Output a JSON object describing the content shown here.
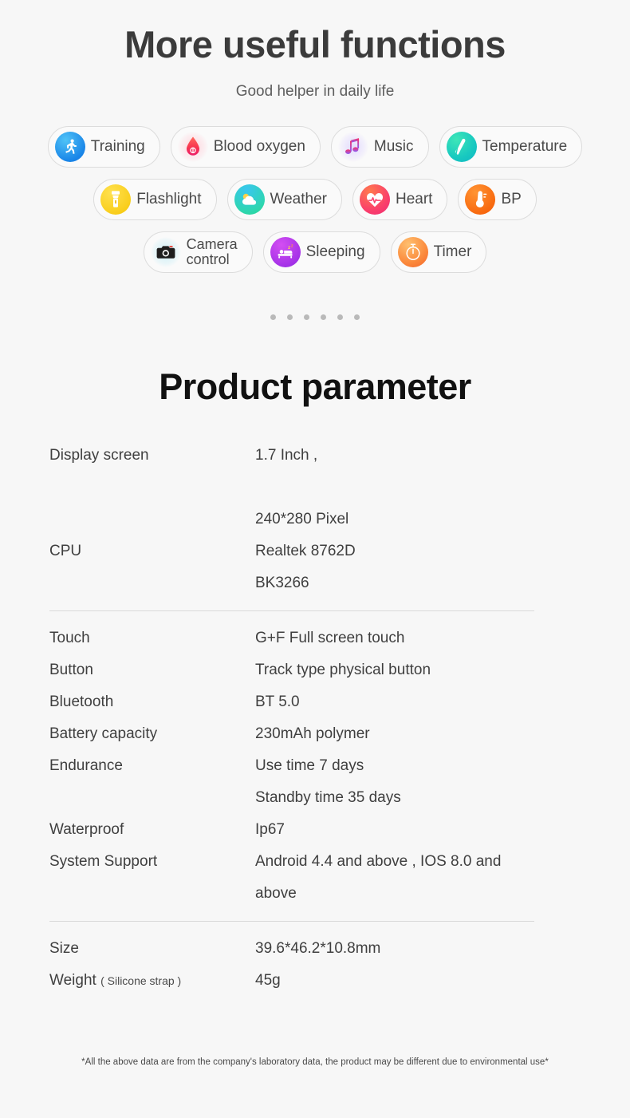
{
  "header": {
    "title": "More useful functions",
    "subtitle": "Good helper in daily life"
  },
  "features": {
    "rows": [
      [
        {
          "label": "Training",
          "icon": "running-icon"
        },
        {
          "label": "Blood oxygen",
          "icon": "blood-drop-icon"
        },
        {
          "label": "Music",
          "icon": "music-note-icon"
        },
        {
          "label": "Temperature",
          "icon": "thermometer-gun-icon"
        }
      ],
      [
        {
          "label": "Flashlight",
          "icon": "flashlight-icon"
        },
        {
          "label": "Weather",
          "icon": "sun-cloud-icon"
        },
        {
          "label": "Heart",
          "icon": "heart-pulse-icon"
        },
        {
          "label": "BP",
          "icon": "thermometer-icon"
        }
      ],
      [
        {
          "label": "Camera\ncontrol",
          "icon": "camera-icon"
        },
        {
          "label": "Sleeping",
          "icon": "bed-icon"
        },
        {
          "label": "Timer",
          "icon": "stopwatch-icon"
        }
      ]
    ],
    "pagination_dots": 6
  },
  "parameters": {
    "title": "Product parameter",
    "groups": [
      {
        "rows": [
          {
            "key": "Display screen",
            "key_sub": "",
            "value": "1.7 Inch ,\n\n240*280 Pixel"
          },
          {
            "key": "CPU",
            "key_sub": "",
            "value": "Realtek 8762D\nBK3266"
          }
        ]
      },
      {
        "rows": [
          {
            "key": "Touch",
            "key_sub": "",
            "value": "G+F Full screen touch"
          },
          {
            "key": "Button",
            "key_sub": "",
            "value": "Track type physical button"
          },
          {
            "key": "Bluetooth",
            "key_sub": "",
            "value": "BT 5.0"
          },
          {
            "key": "Battery capacity",
            "key_sub": "",
            "value": "230mAh polymer"
          },
          {
            "key": "Endurance",
            "key_sub": "",
            "value": "Use time 7 days\nStandby time 35 days"
          },
          {
            "key": "Waterproof",
            "key_sub": "",
            "value": "Ip67"
          },
          {
            "key": "System Support",
            "key_sub": "",
            "value": "Android 4.4 and above , IOS 8.0 and above"
          }
        ]
      },
      {
        "rows": [
          {
            "key": "Size",
            "key_sub": "",
            "value": "39.6*46.2*10.8mm"
          },
          {
            "key": "Weight",
            "key_sub": "( Silicone strap )",
            "value": "45g"
          }
        ]
      }
    ]
  },
  "footnote": "*All the above data are from the company's laboratory data, the product may be different due to environmental use*",
  "colors": {
    "background": "#f7f7f7",
    "title": "#3b3b3b",
    "text": "#3f3f3f",
    "divider": "#d9d9d9",
    "pill_border": "#dcdcdc",
    "dot": "#b9b9b9"
  }
}
